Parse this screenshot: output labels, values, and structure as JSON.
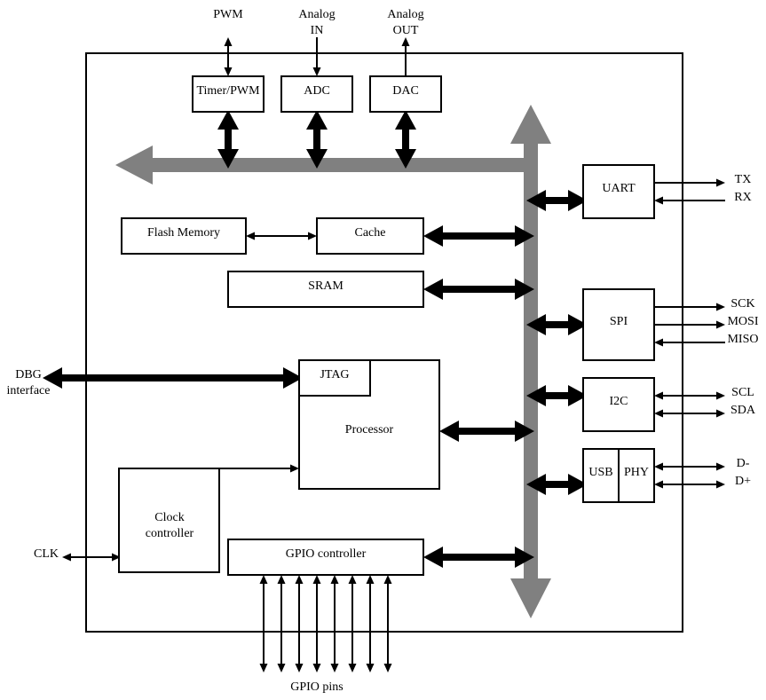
{
  "external": {
    "pwm": "PWM",
    "analog_in": [
      "Analog",
      "IN"
    ],
    "analog_out": [
      "Analog",
      "OUT"
    ],
    "dbg": [
      "DBG",
      "interface"
    ],
    "clk": "CLK",
    "gpio_pins": "GPIO pins",
    "tx": "TX",
    "rx": "RX",
    "sck": "SCK",
    "mosi": "MOSI",
    "miso": "MISO",
    "scl": "SCL",
    "sda": "SDA",
    "dminus": "D-",
    "dplus": "D+"
  },
  "blocks": {
    "timer": "Timer/PWM",
    "adc": "ADC",
    "dac": "DAC",
    "flash": "Flash Memory",
    "cache": "Cache",
    "sram": "SRAM",
    "jtag": "JTAG",
    "processor": "Processor",
    "clock": [
      "Clock",
      "controller"
    ],
    "gpio": "GPIO controller",
    "uart": "UART",
    "spi": "SPI",
    "i2c": "I2C",
    "usb": "USB",
    "phy": "PHY"
  },
  "colors": {
    "bus": "#808080",
    "line": "#000000"
  }
}
